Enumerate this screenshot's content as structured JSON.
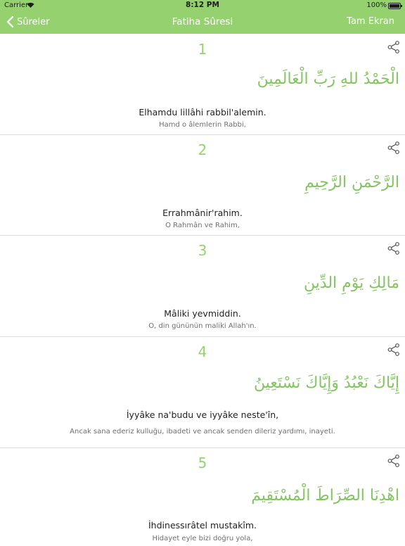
{
  "status": {
    "carrier": "Carrier",
    "time": "8:12 PM",
    "battery": "100%"
  },
  "nav": {
    "back_label": "Sûreler",
    "title": "Fatiha Sûresi",
    "right_label": "Tam Ekran"
  },
  "verses": [
    {
      "number": "1",
      "arabic": "الْحَمْدُ للهِ رَبِّ الْعَالَمِينَ",
      "transliteration": "Elhamdu lillâhi rabbil'alemin.",
      "meaning": "Hamd o âlemlerin Rabbi,"
    },
    {
      "number": "2",
      "arabic": "الرَّحْمَنِ الرَّحِيمِ",
      "transliteration": "Errahmânir'rahim.",
      "meaning": "O Rahmân ve Rahim,"
    },
    {
      "number": "3",
      "arabic": "مَالِكِ يَوْمِ الدِّينِ",
      "transliteration": "Mâliki yevmiddin.",
      "meaning": "O, din gününün maliki Allah'ın."
    },
    {
      "number": "4",
      "arabic": "إِيَّاكَ نَعْبُدُ وَإِيَّاكَ نَسْتَعِينُ",
      "transliteration": "İyyâke na'budu ve iyyâke neste'în,",
      "meaning": "Ancak sana ederiz kulluğu, ibadeti ve ancak senden dileriz yardımı, inayeti."
    },
    {
      "number": "5",
      "arabic": "اهْدِنَا الصِّرَاطَ الْمُسْتَقِيمَ",
      "transliteration": "İhdinessırâtel mustakîm.",
      "meaning": "Hidayet eyle bizi doğru yola,"
    }
  ],
  "colors": {
    "accent": "#96d170",
    "arabic": "#84c462"
  }
}
